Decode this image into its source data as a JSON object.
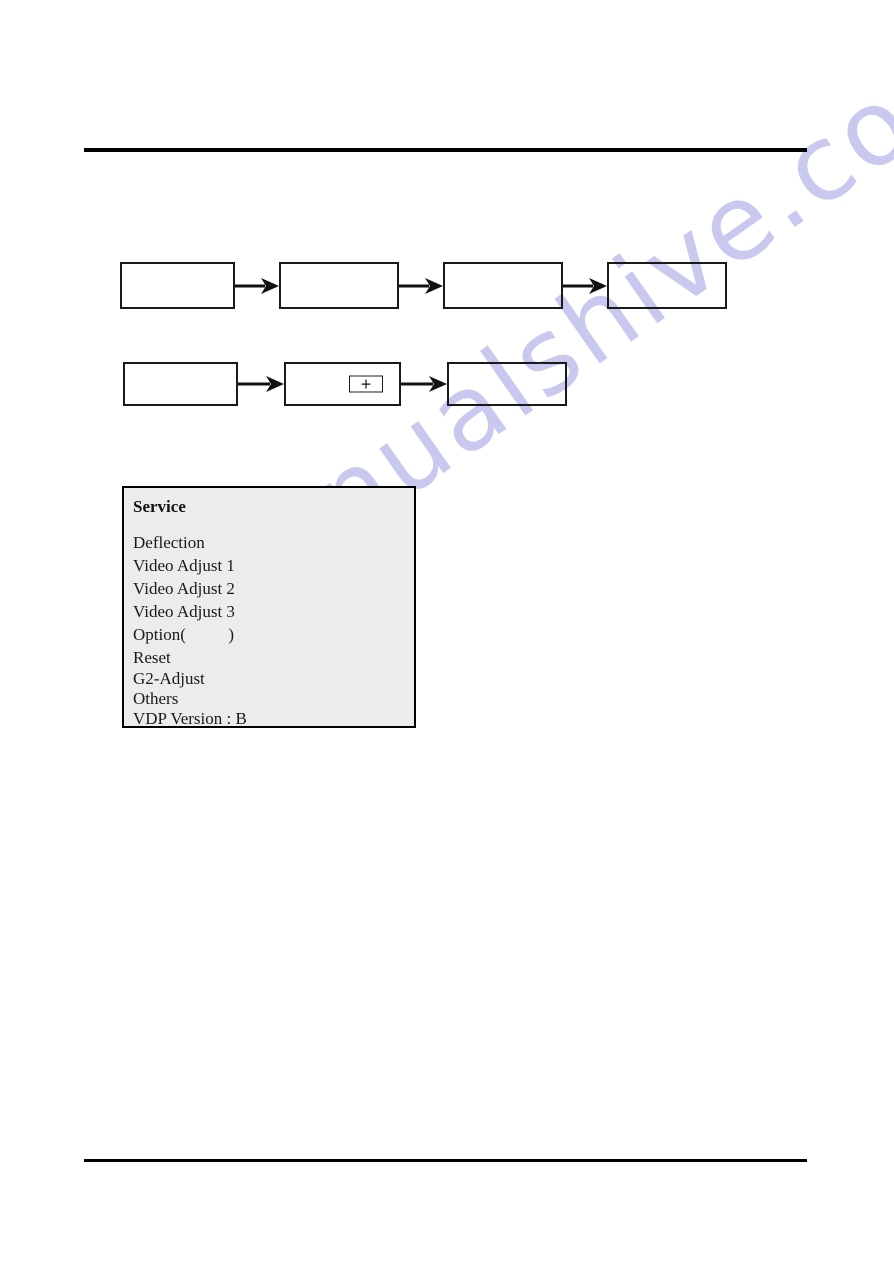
{
  "page": {
    "background_color": "#ffffff",
    "rule_color": "#000000"
  },
  "watermark": {
    "text": "manualshive.com",
    "color": "#c9c9ef"
  },
  "flow_row_1": {
    "boxes": [
      {
        "label": ""
      },
      {
        "label": ""
      },
      {
        "label": ""
      },
      {
        "label": ""
      }
    ]
  },
  "flow_row_2": {
    "boxes": [
      {
        "label": ""
      },
      {
        "label": "",
        "inner_mark": "+"
      },
      {
        "label": ""
      }
    ]
  },
  "service_panel": {
    "title": "Service",
    "background_color": "#ececec",
    "border_color": "#000000",
    "items": [
      {
        "label": "Deflection"
      },
      {
        "label": "Video Adjust 1"
      },
      {
        "label": "Video Adjust 2"
      },
      {
        "label": "Video Adjust 3"
      },
      {
        "label": "Option(          )"
      },
      {
        "label": "Reset"
      },
      {
        "label": "G2-Adjust"
      },
      {
        "label": "Others"
      },
      {
        "label": "VDP Version : B"
      }
    ]
  }
}
